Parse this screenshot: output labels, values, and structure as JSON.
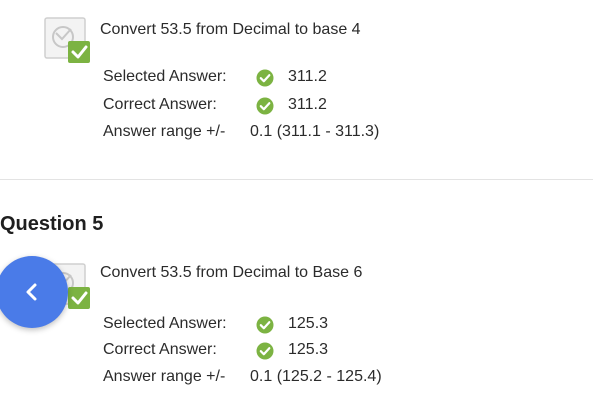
{
  "question_4": {
    "prompt": "Convert 53.5 from Decimal to base 4",
    "selected_label": "Selected Answer:",
    "selected_value": "311.2",
    "correct_label": "Correct Answer:",
    "correct_value": "311.2",
    "range_label": "Answer range +/-",
    "range_value": "0.1 (311.1 - 311.3)"
  },
  "question_5": {
    "heading": "Question 5",
    "prompt": "Convert 53.5 from Decimal to Base 6",
    "selected_label": "Selected Answer:",
    "selected_value": "125.3",
    "correct_label": "Correct Answer:",
    "correct_value": "125.3",
    "range_label": "Answer range +/-",
    "range_value": "0.1 (125.2 - 125.4)"
  },
  "icons": {
    "question_icon": "question-correct-icon",
    "check_icon": "check-circle-icon",
    "back_icon": "chevron-left-icon"
  },
  "colors": {
    "correct_green": "#7cb342",
    "back_button": "#4a7be8"
  }
}
